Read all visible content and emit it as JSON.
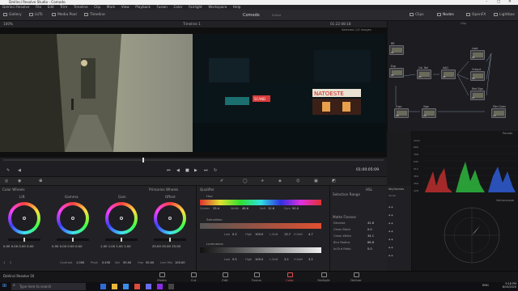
{
  "window": {
    "title": "DaVinci Resolve Studio - Comodo"
  },
  "menu": [
    "DaVinci Resolve",
    "File",
    "Edit",
    "Trim",
    "Timeline",
    "Clip",
    "Mark",
    "View",
    "Playback",
    "Fusion",
    "Color",
    "Fairlight",
    "Workspace",
    "Help"
  ],
  "toolbar": {
    "left": [
      "Gallery",
      "LUTs",
      "Media Pool",
      "Timeline"
    ],
    "project": "Comodo",
    "project_status": "Edited",
    "right": [
      "Clips",
      "Nodes",
      "OpenFX",
      "Lightbox"
    ]
  },
  "viewer": {
    "zoom": "100%",
    "timeline": "Timeline 1",
    "timecode_top": "01:22:08:18",
    "selected_label": "Selected 1/3 images",
    "clip_label": "Clip",
    "timecode": "01:00:05:09",
    "signs": [
      "NATOESTE",
      "SCAND"
    ]
  },
  "nodes": {
    "labels": [
      "RR",
      "Exp",
      "Col. Bal",
      "Adj1",
      "Look",
      "Output",
      "Red Sign",
      "Fuse",
      "Vign",
      "Film Grain"
    ],
    "numbers": [
      "01",
      "02",
      "03",
      "04",
      "05",
      "06",
      "07",
      "08",
      "09",
      "10"
    ]
  },
  "scopes": {
    "parade_title": "Parade",
    "parade_ticks": [
      "1023",
      "896",
      "768",
      "640",
      "512",
      "384",
      "256",
      "128",
      "0"
    ],
    "vectorscope_title": "Vectorscope"
  },
  "color_wheels": {
    "title": "Color Wheels",
    "mode": "Primaries Wheels",
    "wheels": [
      {
        "name": "Lift",
        "values": [
          "0.00",
          "0.00",
          "0.00",
          "0.00"
        ]
      },
      {
        "name": "Gamma",
        "values": [
          "0.00",
          "0.00",
          "0.00",
          "0.00"
        ]
      },
      {
        "name": "Gain",
        "values": [
          "1.00",
          "1.00",
          "1.00",
          "1.00"
        ]
      },
      {
        "name": "Offset",
        "values": [
          "25.00",
          "25.00",
          "25.00"
        ]
      }
    ],
    "bottom": {
      "contrast_label": "Contrast",
      "contrast": "1.000",
      "pivot_label": "Pivot",
      "pivot": "0.435",
      "sat_label": "Sat",
      "sat": "50.00",
      "hue_label": "Hue",
      "hue": "50.00",
      "lummix_label": "Lum Mix",
      "lummix": "100.00",
      "page_nums": [
        "1",
        "2"
      ]
    }
  },
  "qualifier": {
    "title": "Qualifier",
    "hue": {
      "label": "Hue",
      "center_l": "Center",
      "center": "33.4",
      "width_l": "Width",
      "width": "48.6",
      "soft_l": "Soft",
      "soft": "12.6",
      "sym_l": "Sym",
      "sym": "50.0"
    },
    "saturation": {
      "label": "Saturation",
      "low_l": "Low",
      "low": "0.2",
      "high_l": "High",
      "high": "100.0",
      "lsoft_l": "L.Soft",
      "lsoft": "13.7",
      "hsoft_l": "H.Soft",
      "hsoft": "4.7"
    },
    "luminance": {
      "label": "Luminance",
      "low_l": "Low",
      "low": "5.5",
      "high_l": "High",
      "high": "100.0",
      "lsoft_l": "L.Soft",
      "lsoft": "3.2",
      "hsoft_l": "H.Soft",
      "hsoft": "3.2"
    }
  },
  "selection_range": {
    "title": "Selection Range",
    "mode": "HSL",
    "matte_label": "Matte Finesse",
    "rows": [
      {
        "label": "Denoise",
        "value": "42.6"
      },
      {
        "label": "Clean Black",
        "value": "0.0"
      },
      {
        "label": "Clean White",
        "value": "34.1"
      },
      {
        "label": "Blur Radius",
        "value": "66.6"
      },
      {
        "label": "In/Out Ratio",
        "value": "0.0"
      }
    ]
  },
  "keyframes": {
    "title": "Keyframes",
    "time": "00:00"
  },
  "pages": [
    "Media",
    "Cut",
    "Edit",
    "Fusion",
    "Color",
    "Fairlight",
    "Deliver"
  ],
  "active_page": "Color",
  "version": "DaVinci Resolve 16",
  "taskbar": {
    "search": "Type here to search",
    "time": "9:18 PM",
    "date": "8/10/2020",
    "lang": "ENG"
  }
}
